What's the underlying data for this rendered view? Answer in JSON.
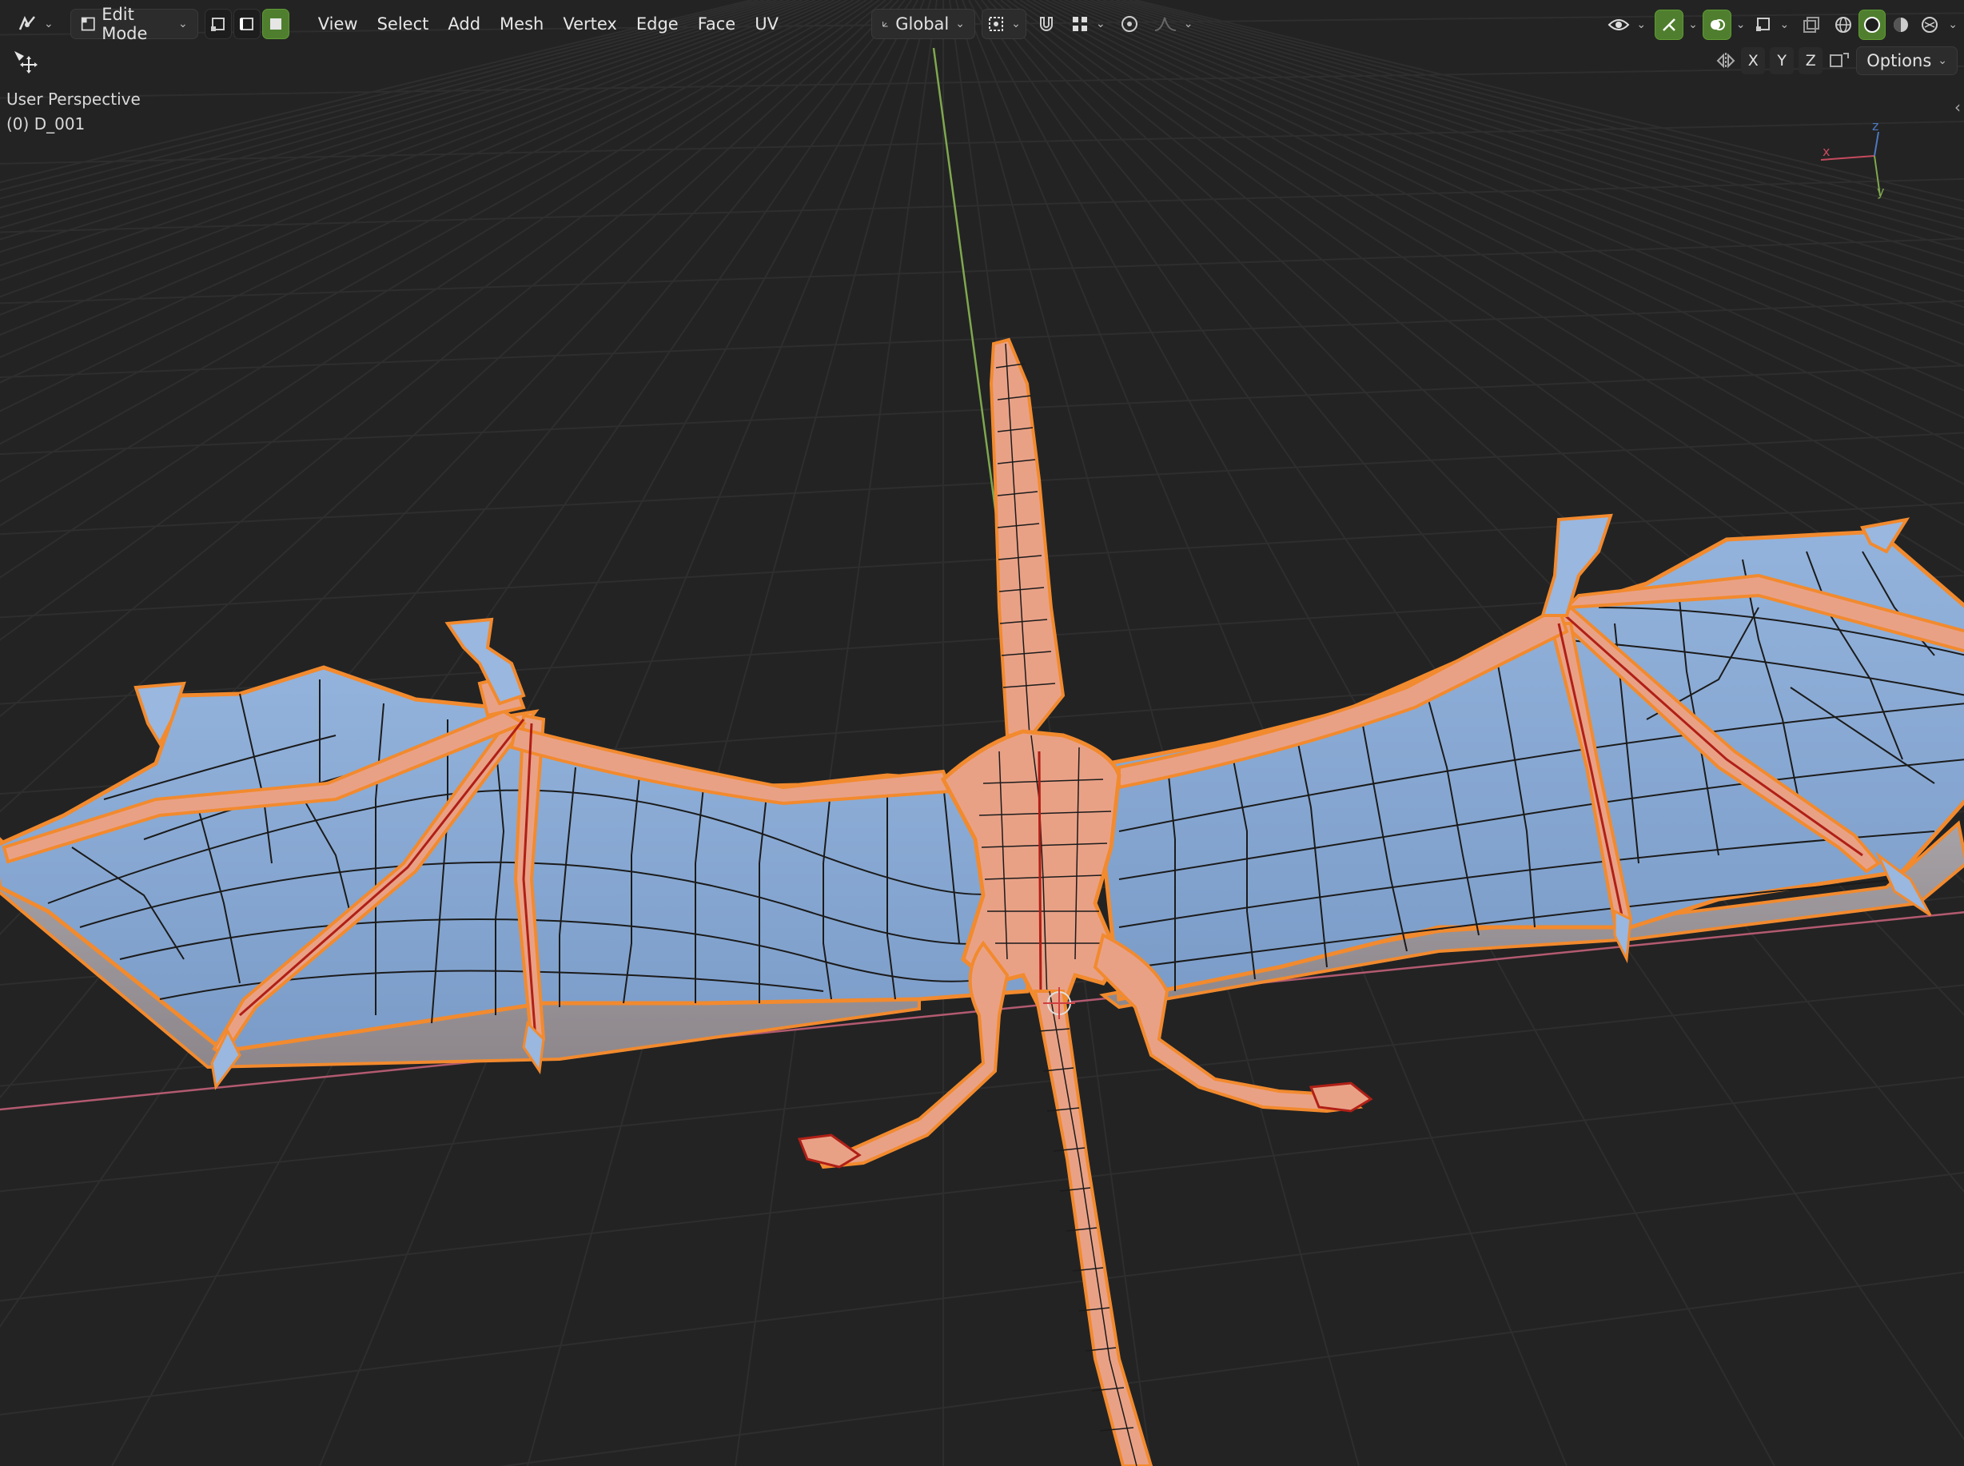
{
  "header": {
    "mode_label": "Edit Mode",
    "menus": [
      "View",
      "Select",
      "Add",
      "Mesh",
      "Vertex",
      "Edge",
      "Face",
      "UV"
    ],
    "orientation_label": "Global",
    "options_label": "Options",
    "axis_toggles": [
      "X",
      "Y",
      "Z"
    ]
  },
  "viewport": {
    "view_name": "User Perspective",
    "object_info": "(0) D_001"
  },
  "gizmo": {
    "x_label": "x",
    "y_label": "y",
    "z_label": "z"
  },
  "colors": {
    "background": "#232323",
    "grid": "#2d2d2d",
    "wing_face": "#87a8d3",
    "body_face": "#e9a186",
    "selected_edge": "#f28a2e",
    "seam": "#b01f16",
    "x_axis": "#b35a70",
    "y_axis": "#7fa84e"
  }
}
